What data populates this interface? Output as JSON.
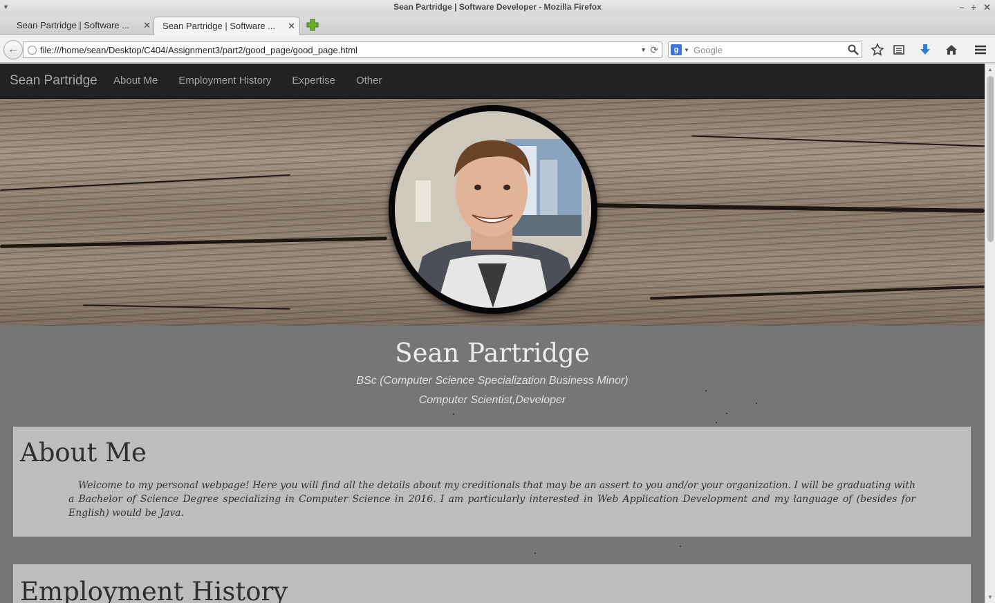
{
  "window": {
    "title": "Sean Partridge | Software Developer - Mozilla Firefox",
    "controls": [
      "–",
      "+",
      "✕"
    ]
  },
  "tabs": [
    {
      "label": "Sean Partridge | Software ...",
      "active": false
    },
    {
      "label": "Sean Partridge | Software ...",
      "active": true
    }
  ],
  "toolbar": {
    "url": "file:///home/sean/Desktop/C404/Assignment3/part2/good_page/good_page.html",
    "search_placeholder": "Google",
    "search_engine_letter": "g"
  },
  "site": {
    "brand": "Sean Partridge",
    "nav": [
      "About Me",
      "Employment History",
      "Expertise",
      "Other"
    ],
    "name": "Sean Partridge",
    "degree": "BSc (Computer Science Specialization Business Minor)",
    "role": "Computer Scientist,Developer",
    "about": {
      "heading": "About Me",
      "text": "Welcome to my personal webpage! Here you will find all the details about my creditionals that may be an assert to you and/or your organization. I will be graduating with a Bachelor of Science Degree specializing in Computer Science in 2016. I am particularly interested in Web Application Development and my language of (besides for English) would be Java."
    },
    "employment": {
      "heading": "Employment History"
    }
  },
  "colors": {
    "site_nav_bg": "#222222",
    "page_bg": "#767676",
    "panel_bg": "#bdbdbd",
    "download_icon": "#2f7fd8",
    "new_tab_icon": "#6ab02e"
  }
}
